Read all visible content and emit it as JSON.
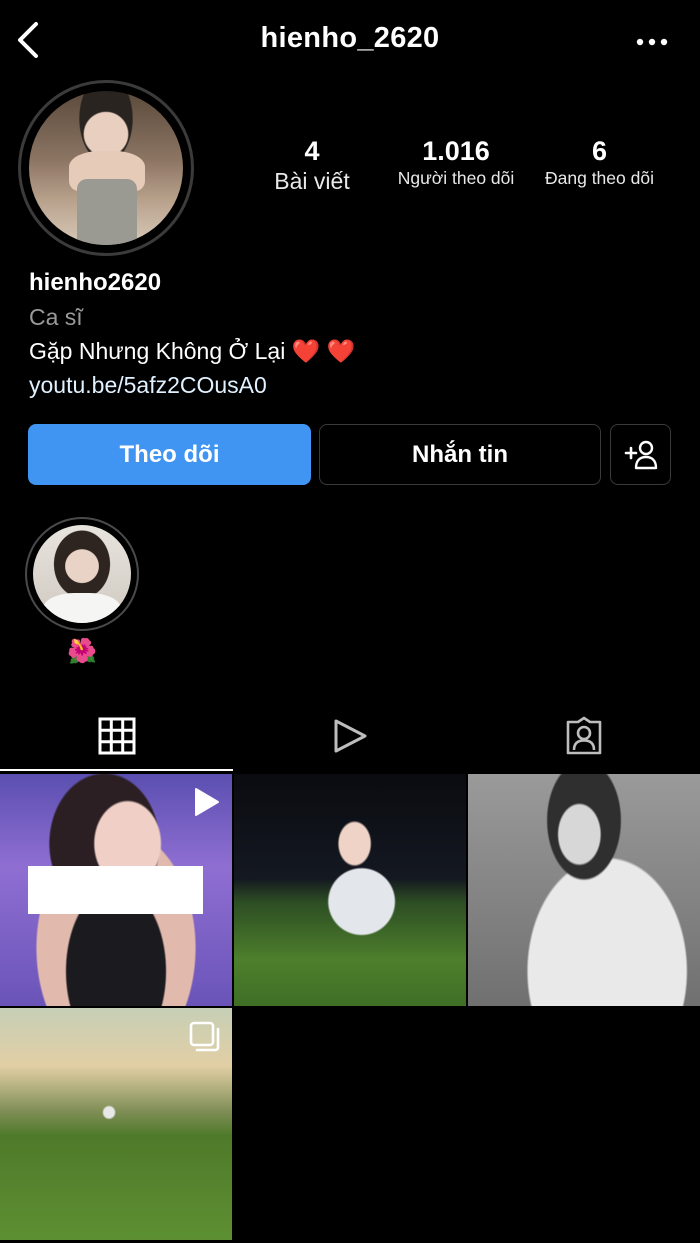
{
  "header": {
    "username": "hienho_2620",
    "back_icon": "chevron-left-icon",
    "more_icon": "more-horizontal-icon"
  },
  "profile": {
    "avatar_icon": "profile-avatar",
    "stats": {
      "posts": {
        "value": "4",
        "label": "Bài viết"
      },
      "followers": {
        "value": "1.016",
        "label": "Người theo dõi"
      },
      "following": {
        "value": "6",
        "label": "Đang theo dõi"
      }
    },
    "name": "hienho2620",
    "category": "Ca sĩ",
    "bio": "Gặp Nhưng Không Ở Lại ❤️ ❤️",
    "link": "youtu.be/5afz2COusA0"
  },
  "actions": {
    "follow_label": "Theo dõi",
    "message_label": "Nhắn tin",
    "add_user_icon": "add-user-icon"
  },
  "highlights": [
    {
      "label": "🌺"
    }
  ],
  "tabs": [
    {
      "icon": "grid-icon",
      "active": true
    },
    {
      "icon": "reels-icon",
      "active": false
    },
    {
      "icon": "tagged-icon",
      "active": false
    }
  ],
  "grid": [
    {
      "type": "reel",
      "overlay_icon": "play-icon"
    },
    {
      "type": "photo"
    },
    {
      "type": "photo"
    },
    {
      "type": "carousel",
      "overlay_icon": "carousel-icon"
    }
  ],
  "colors": {
    "background": "#000000",
    "follow_button": "#4094f2",
    "border": "#3a3a3a",
    "muted_text": "#9a9a9a"
  }
}
